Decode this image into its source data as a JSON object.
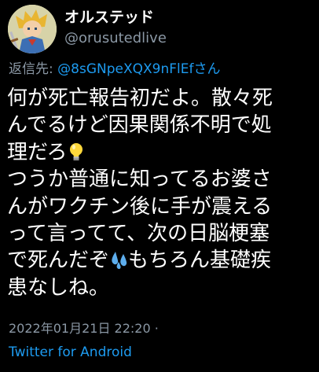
{
  "author": {
    "display_name": "オルステッド",
    "handle": "@orusutedlive",
    "avatar_icon": "anime-character-avatar-icon"
  },
  "reply": {
    "prefix": "返信先: ",
    "target": "@8sGNpeXQX9nFlEfさん"
  },
  "body": {
    "line1": "何が死亡報告初だよ。散々死",
    "line2": "んでるけど因果関係不明で処",
    "line3": "理だろ",
    "line3_emoji": "light-bulb-icon",
    "line4": "つうか普通に知ってるお婆さ",
    "line5": "んがワクチン後に手が震える",
    "line6": "って言ってて、次の日脳梗塞",
    "line7_a": "で死んだぞ",
    "line7_emoji": "sweat-droplets-icon",
    "line7_b": "もちろん基礎疾",
    "line8": "患なしね。"
  },
  "meta": {
    "timestamp": "2022年01月21日 22:20 ·",
    "source": "Twitter for Android"
  },
  "colors": {
    "background": "#000000",
    "text": "#ffffff",
    "secondary": "#8b98a5",
    "link": "#1d9bf0"
  }
}
